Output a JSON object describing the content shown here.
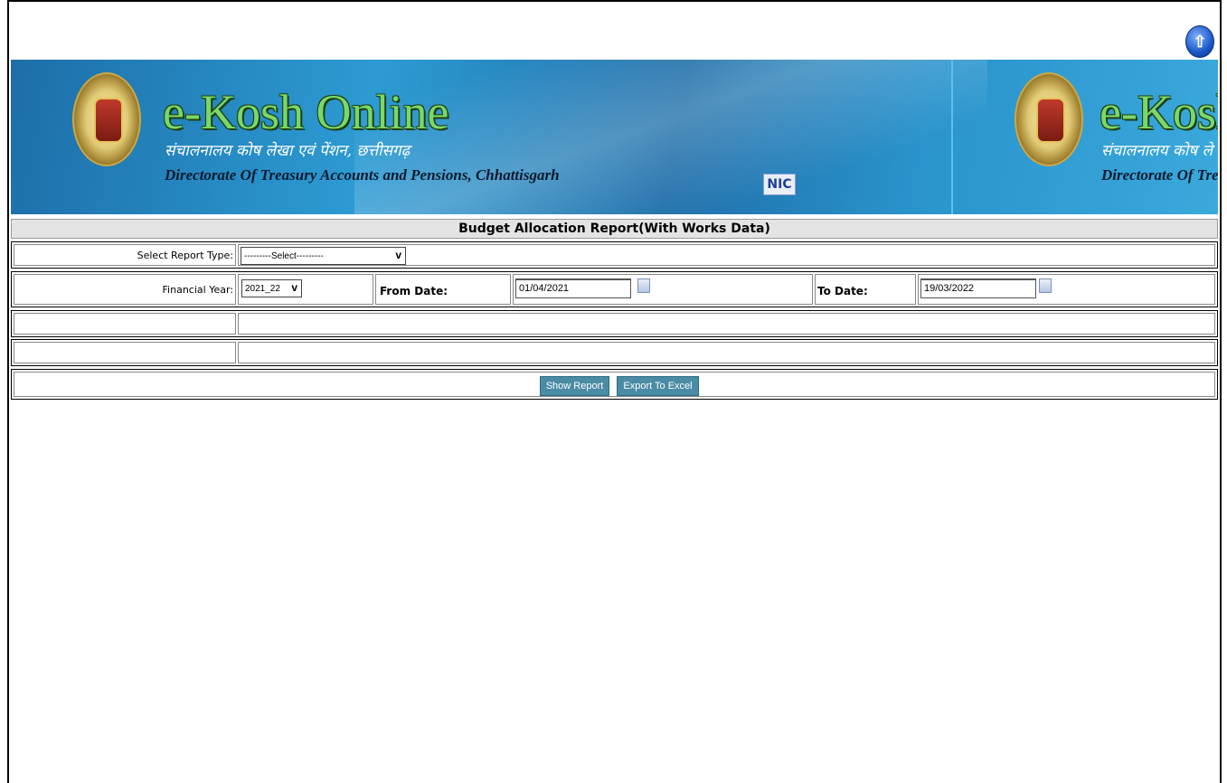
{
  "header": {
    "home_icon": "home-up-arrow-icon"
  },
  "banner": {
    "title": "e-Kosh Online",
    "title_short": "e-Kosh",
    "hindi_subtitle": "संचालनालय कोष लेखा एवं पेंशन, छत्तीसगढ़",
    "hindi_subtitle_short": "संचालनालय कोष ले",
    "english_subtitle": "Directorate Of Treasury Accounts and Pensions, Chhattisgarh",
    "english_subtitle_short": "Directorate Of Treas",
    "nic_logo": "NIC"
  },
  "report": {
    "title": "Budget Allocation Report(With Works Data)"
  },
  "form": {
    "report_type_label": "Select Report Type:",
    "report_type_value": "---------Select---------",
    "financial_year_label": "Financial Year:",
    "financial_year_value": "2021_22",
    "from_date_label": "From Date:",
    "from_date_value": "01/04/2021",
    "to_date_label": "To Date:",
    "to_date_value": "19/03/2022"
  },
  "buttons": {
    "show_report": "Show Report",
    "export_excel": "Export To Excel"
  }
}
